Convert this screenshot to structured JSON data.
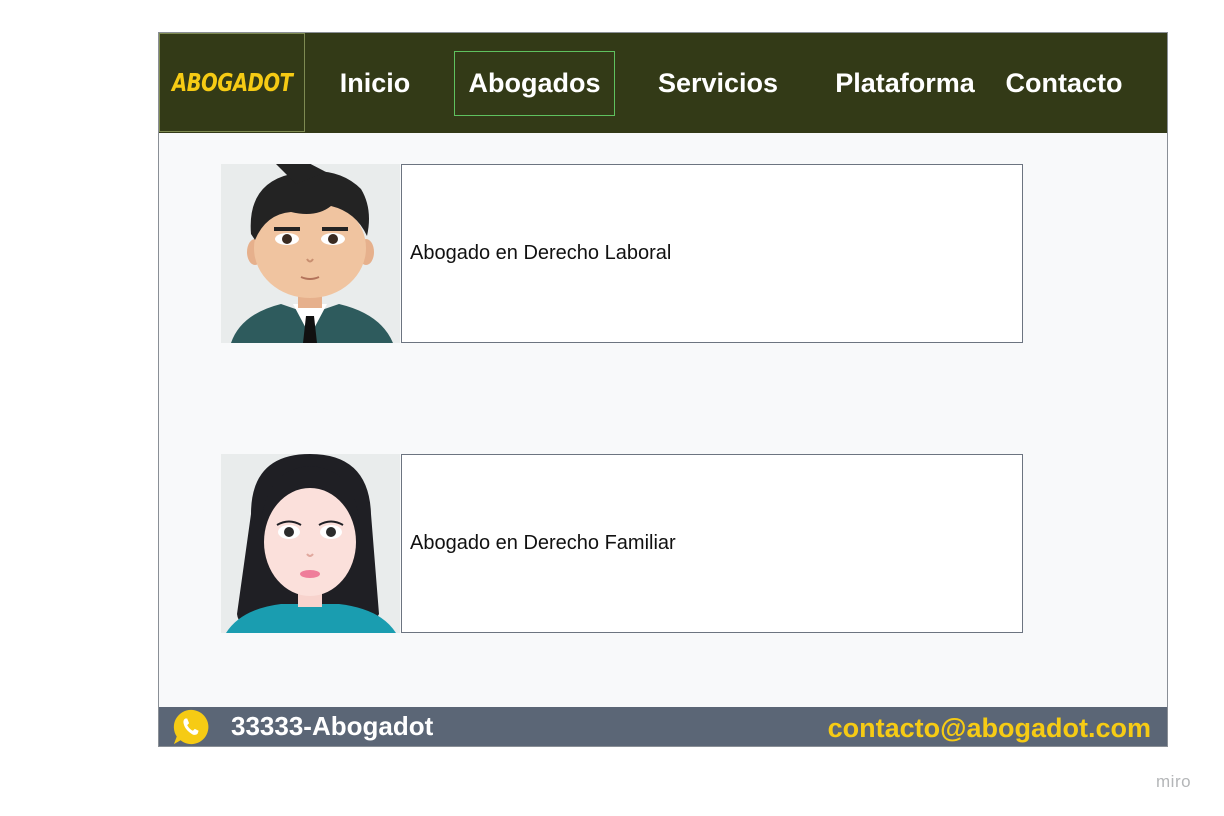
{
  "brand": {
    "logo_text": "ABOGADOT",
    "accent_color": "#f6cb14",
    "nav_bg": "#333a17"
  },
  "nav": {
    "items": [
      {
        "label": "Inicio",
        "active": false
      },
      {
        "label": "Abogados",
        "active": true
      },
      {
        "label": "Servicios",
        "active": false
      },
      {
        "label": "Plataforma",
        "active": false
      },
      {
        "label": "Contacto",
        "active": false
      }
    ]
  },
  "lawyers": [
    {
      "avatar_icon": "male-lawyer-avatar",
      "specialty": "Abogado en Derecho Laboral"
    },
    {
      "avatar_icon": "female-lawyer-avatar",
      "specialty": "Abogado en Derecho Familiar"
    }
  ],
  "footer": {
    "icon": "whatsapp-icon",
    "phone": "33333-Abogadot",
    "email": "contacto@abogadot.com",
    "bg_color": "#5b6676"
  },
  "watermark": "miro"
}
